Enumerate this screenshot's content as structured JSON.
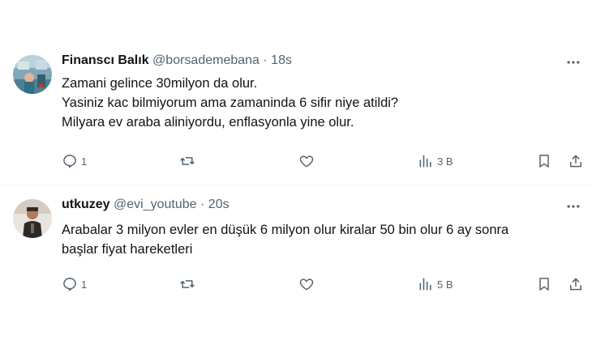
{
  "tweets": [
    {
      "author_name": "Finanscı Balık",
      "handle": "@borsademebana",
      "separator": "·",
      "time": "18s",
      "text_lines": [
        "Zamani gelince 30milyon da olur.",
        "Yasiniz kac bilmiyorum ama zamaninda 6 sifir niye atildi?",
        "Milyara ev araba aliniyordu, enflasyonla yine olur."
      ],
      "replies": "1",
      "views": "3 B",
      "icons": {
        "reply": "reply-icon",
        "retweet": "retweet-icon",
        "like": "heart-icon",
        "views": "views-bar-chart-icon",
        "bookmark": "bookmark-icon",
        "share": "share-icon",
        "more": "more-dots-icon"
      }
    },
    {
      "author_name": "utkuzey",
      "handle": "@evi_youtube",
      "separator": "·",
      "time": "20s",
      "text_lines": [
        "Arabalar 3 milyon evler en düşük 6 milyon olur kiralar 50 bin olur 6 ay sonra",
        "başlar fiyat hareketleri"
      ],
      "replies": "1",
      "views": "5 B",
      "icons": {
        "reply": "reply-icon",
        "retweet": "retweet-icon",
        "like": "heart-icon",
        "views": "views-bar-chart-icon",
        "bookmark": "bookmark-icon",
        "share": "share-icon",
        "more": "more-dots-icon"
      }
    }
  ],
  "colors": {
    "text_primary": "#0f1419",
    "text_secondary": "#536471",
    "divider": "#eff3f4"
  }
}
